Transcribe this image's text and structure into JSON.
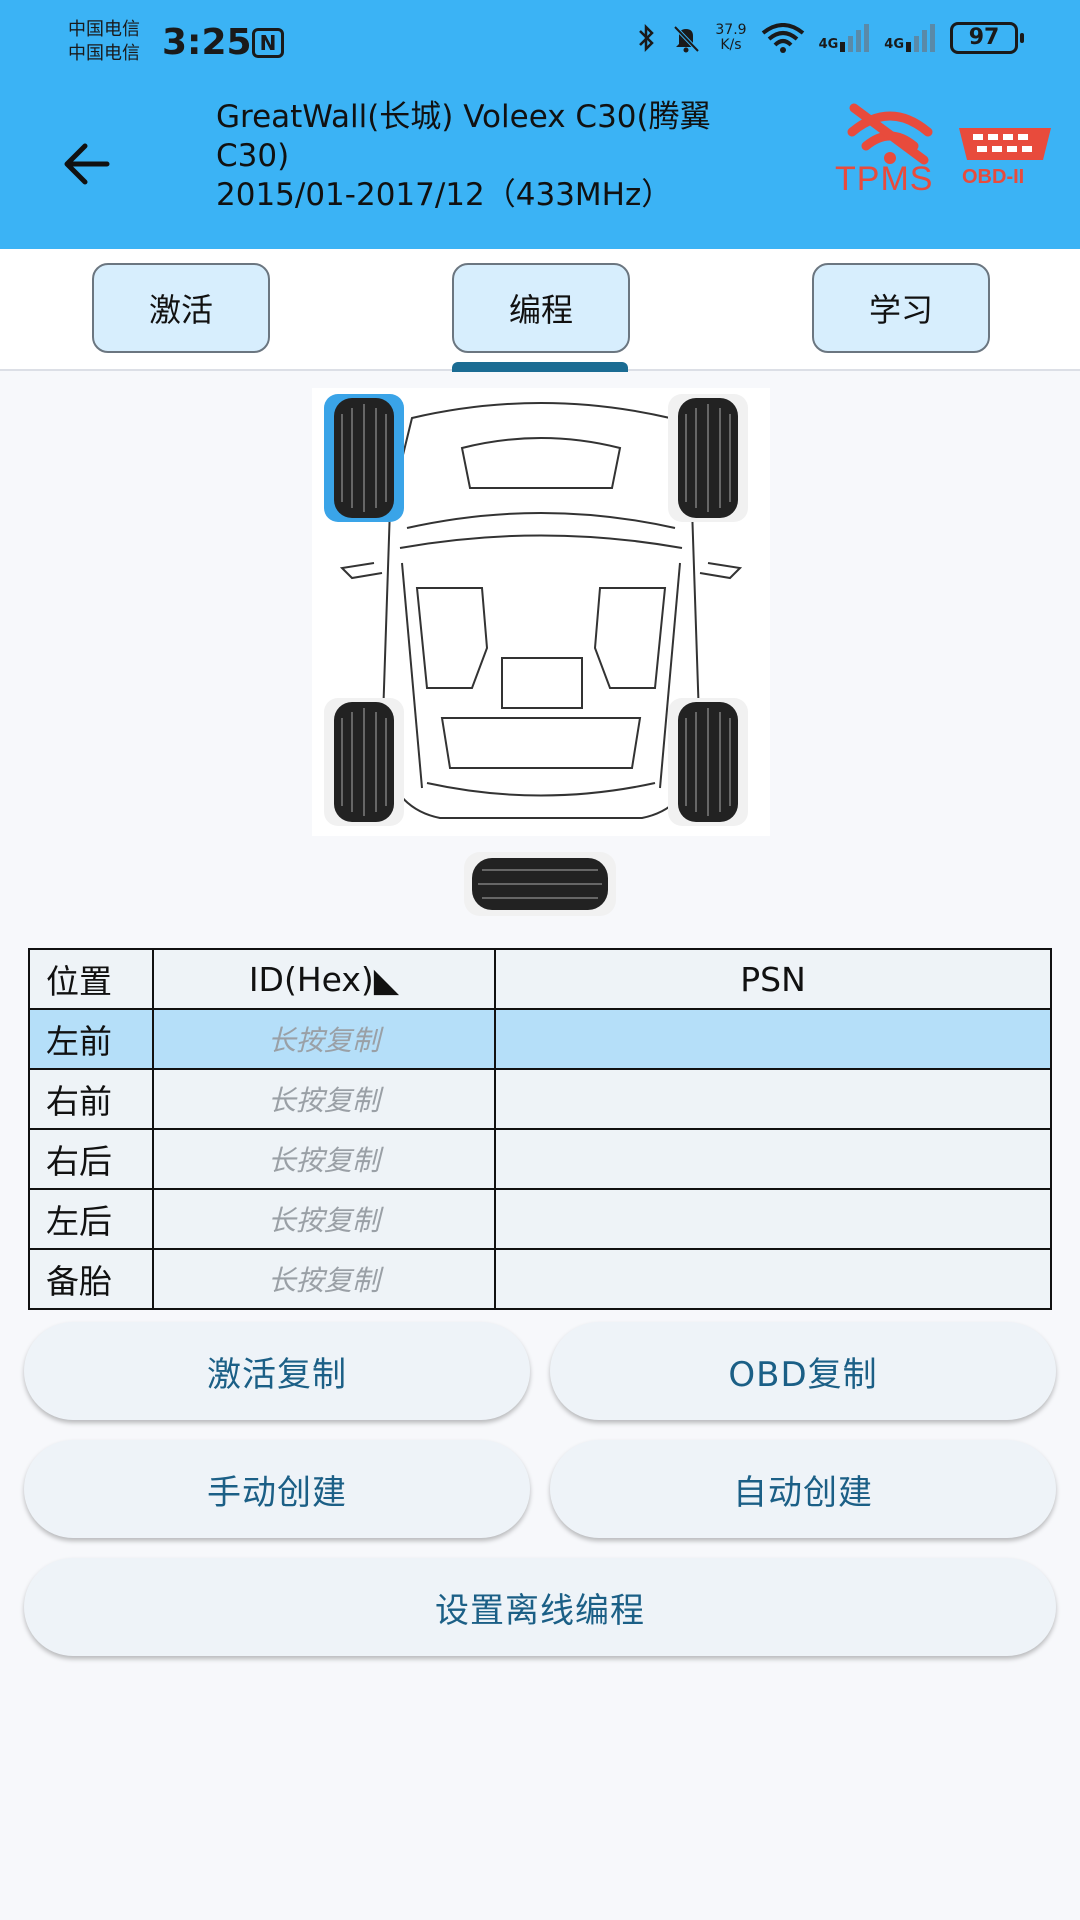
{
  "status_bar": {
    "carrier1": "中国电信",
    "carrier2": "中国电信",
    "time": "3:25",
    "nfc": "N",
    "speed_value": "37.9",
    "speed_unit": "K/s",
    "net1": "4G",
    "net2": "4G",
    "battery": "97"
  },
  "header": {
    "title_line1": "GreatWall(长城) Voleex C30(腾翼",
    "title_line2": "C30)",
    "title_line3": "2015/01-2017/12（433MHz）",
    "tpms_label": "TPMS",
    "obd_label": "OBD-II",
    "bg_color": "#3bb3f5",
    "logo_color": "#e84b3c"
  },
  "tabs": [
    {
      "label": "激活"
    },
    {
      "label": "编程",
      "selected": true
    },
    {
      "label": "学习"
    }
  ],
  "table": {
    "headers": {
      "position": "位置",
      "id": "ID(Hex)◣",
      "psn": "PSN"
    },
    "rows": [
      {
        "position": "左前",
        "id": "长按复制",
        "psn": "",
        "selected": true
      },
      {
        "position": "右前",
        "id": "长按复制",
        "psn": ""
      },
      {
        "position": "右后",
        "id": "长按复制",
        "psn": ""
      },
      {
        "position": "左后",
        "id": "长按复制",
        "psn": ""
      },
      {
        "position": "备胎",
        "id": "长按复制",
        "psn": ""
      }
    ]
  },
  "buttons": {
    "activate_copy": "激活复制",
    "obd_copy": "OBD复制",
    "manual_create": "手动创建",
    "auto_create": "自动创建",
    "offline_program": "设置离线编程"
  }
}
